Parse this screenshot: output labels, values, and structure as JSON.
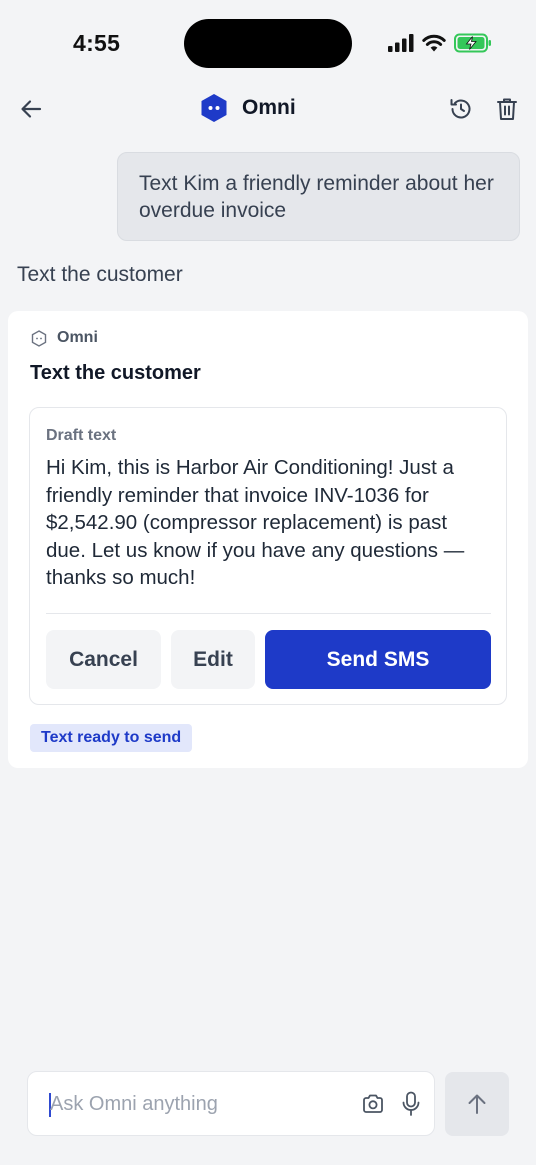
{
  "status_bar": {
    "time": "4:55"
  },
  "header": {
    "title": "Omni"
  },
  "conversation": {
    "user_message": "Text Kim a friendly reminder about her overdue invoice",
    "response_label": "Text the customer"
  },
  "card": {
    "agent_name": "Omni",
    "title": "Text the customer",
    "draft_label": "Draft text",
    "draft_body": "Hi Kim, this is Harbor Air Conditioning! Just a friendly reminder that invoice INV-1036 for $2,542.90 (compressor replacement) is past due. Let us know if you have any questions — thanks so much!",
    "buttons": {
      "cancel": "Cancel",
      "edit": "Edit",
      "send": "Send SMS"
    },
    "status_badge": "Text ready to send"
  },
  "composer": {
    "placeholder": "Ask Omni anything"
  },
  "colors": {
    "accent": "#1e3ac8",
    "badge_bg": "#e2e7fb",
    "battery": "#34c759"
  }
}
